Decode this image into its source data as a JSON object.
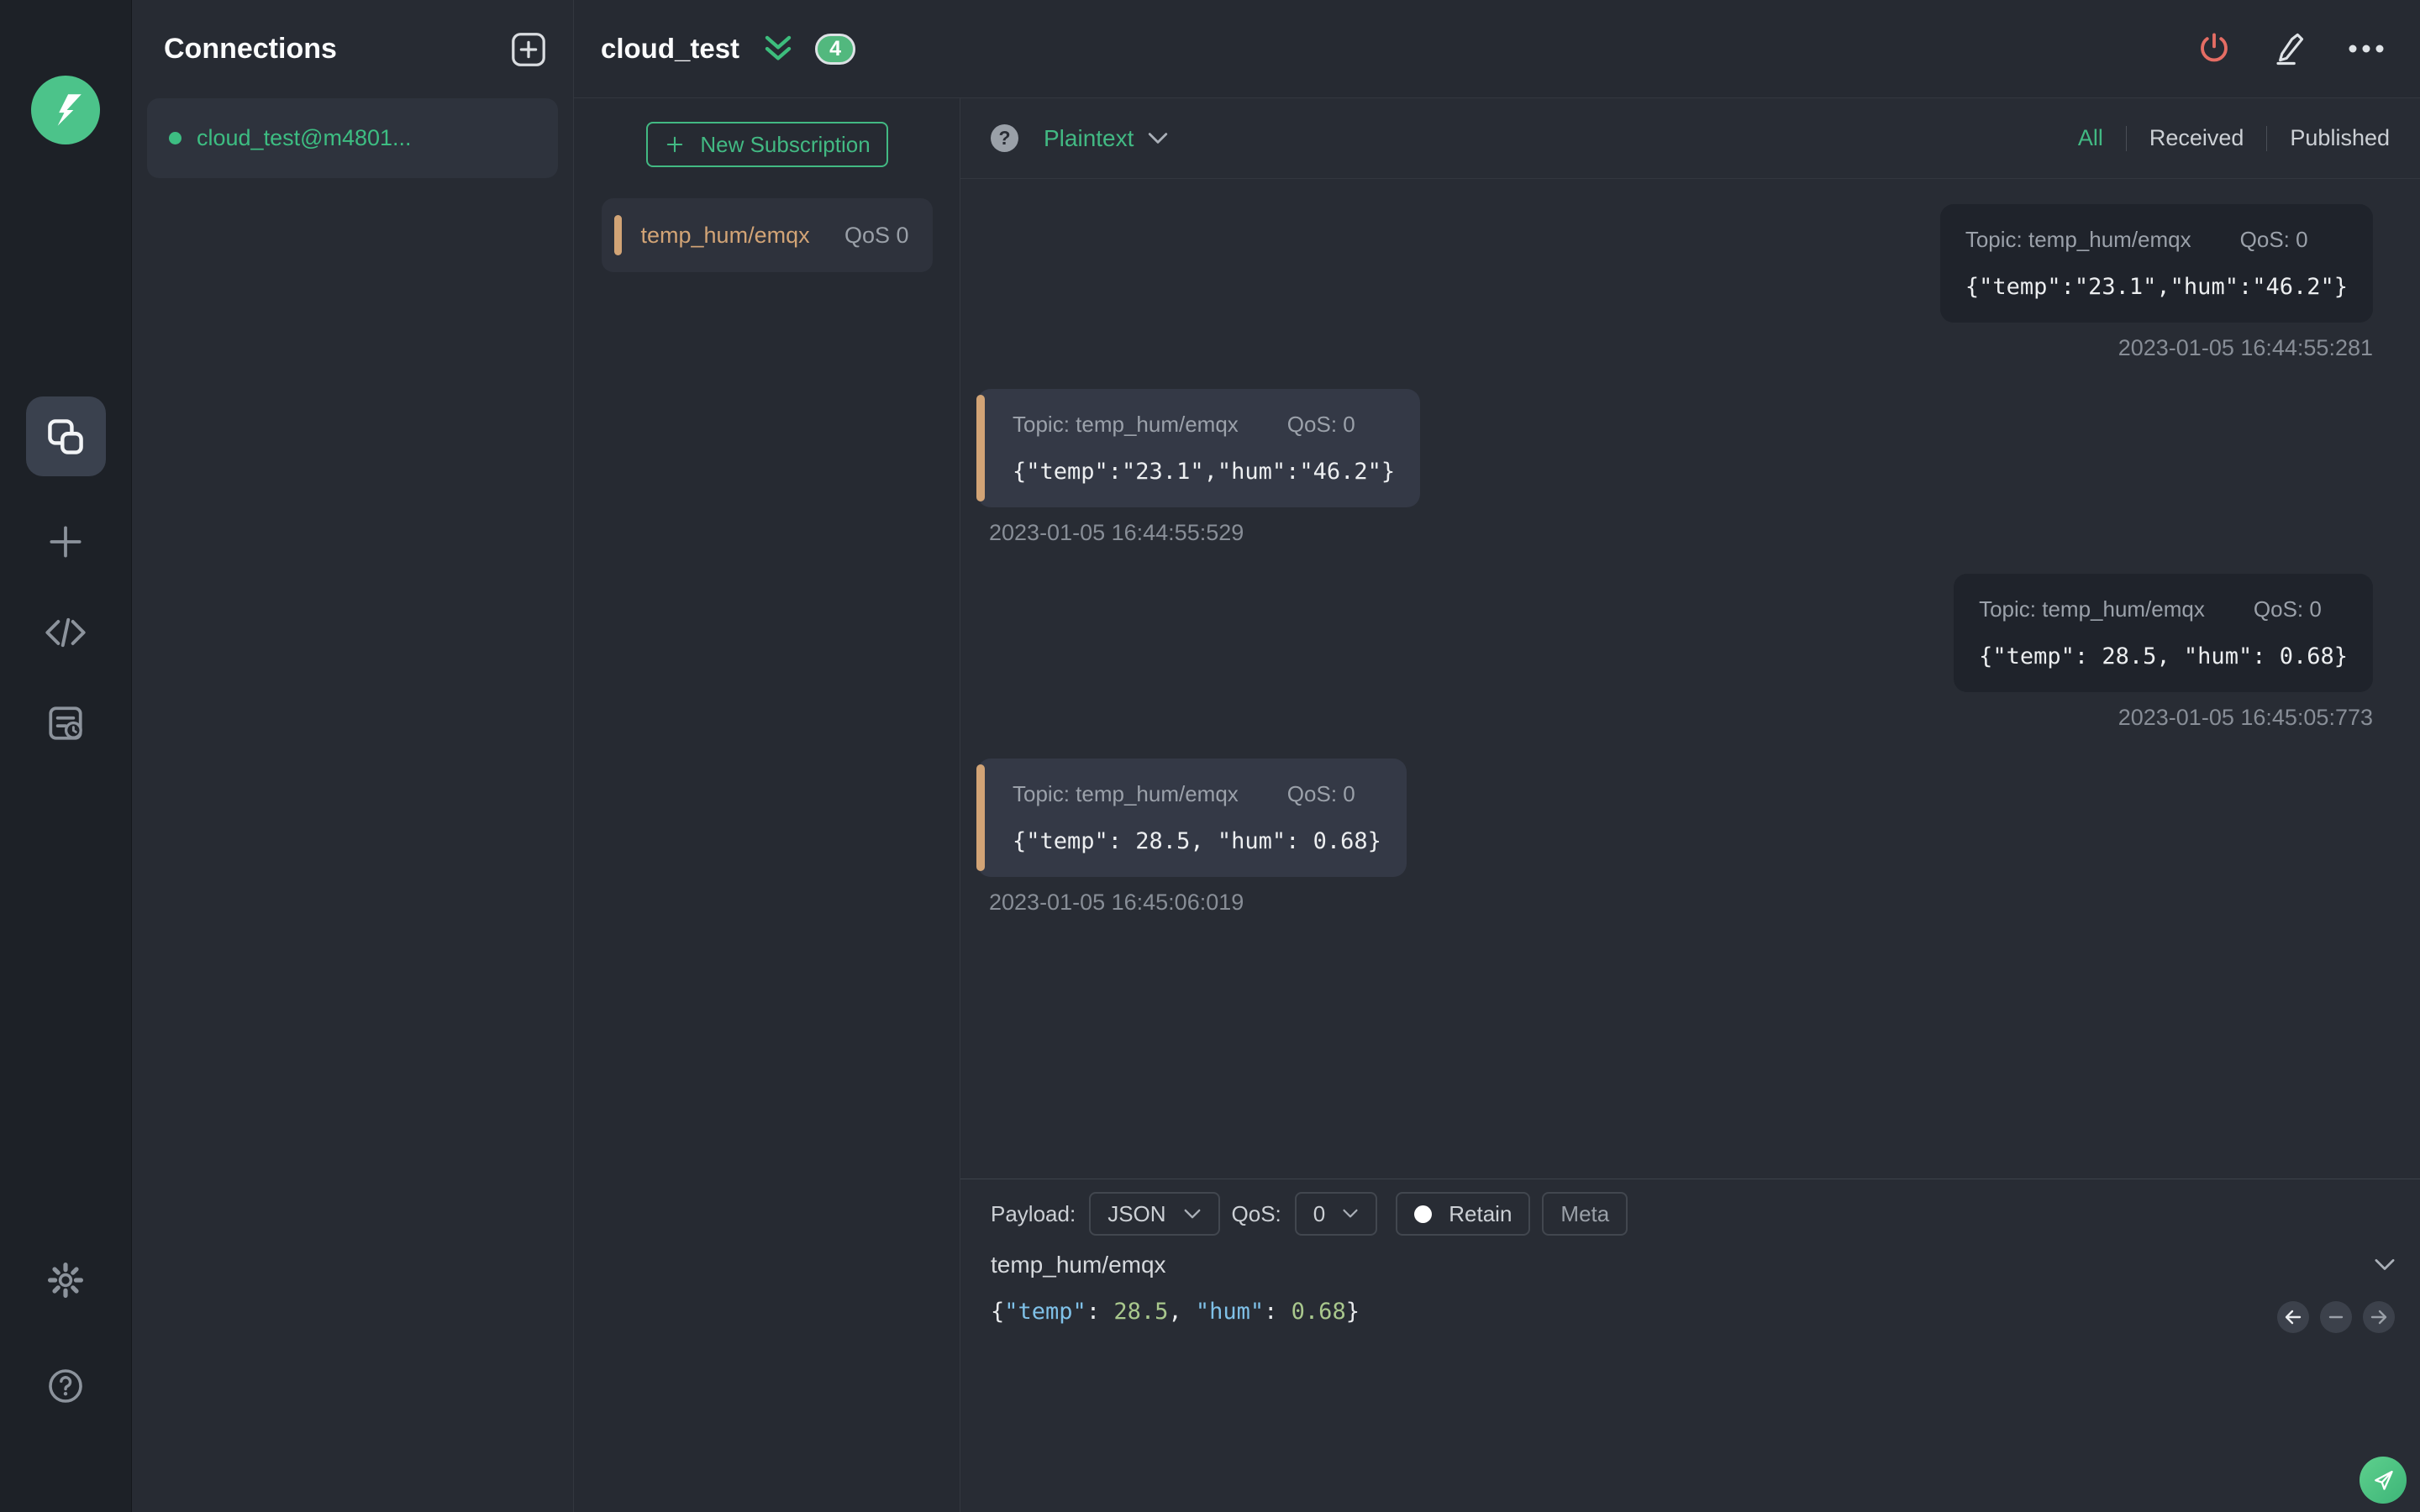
{
  "connections_panel": {
    "title": "Connections",
    "connection_name": "cloud_test@m4801..."
  },
  "header": {
    "title": "cloud_test",
    "message_count": "4"
  },
  "subscriptions": {
    "new_subscription_label": "New Subscription",
    "item": {
      "topic": "temp_hum/emqx",
      "qos": "QoS 0"
    }
  },
  "msgs_toolbar": {
    "help_glyph": "?",
    "format": "Plaintext",
    "filter_all": "All",
    "filter_received": "Received",
    "filter_published": "Published"
  },
  "messages": [
    {
      "direction": "published",
      "topic_label": "Topic: temp_hum/emqx",
      "qos_label": "QoS: 0",
      "payload": "{\"temp\":\"23.1\",\"hum\":\"46.2\"}",
      "timestamp": "2023-01-05 16:44:55:281"
    },
    {
      "direction": "received",
      "topic_label": "Topic: temp_hum/emqx",
      "qos_label": "QoS: 0",
      "payload": "{\"temp\":\"23.1\",\"hum\":\"46.2\"}",
      "timestamp": "2023-01-05 16:44:55:529"
    },
    {
      "direction": "published",
      "topic_label": "Topic: temp_hum/emqx",
      "qos_label": "QoS: 0",
      "payload": "{\"temp\": 28.5, \"hum\": 0.68}",
      "timestamp": "2023-01-05 16:45:05:773"
    },
    {
      "direction": "received",
      "topic_label": "Topic: temp_hum/emqx",
      "qos_label": "QoS: 0",
      "payload": "{\"temp\": 28.5, \"hum\": 0.68}",
      "timestamp": "2023-01-05 16:45:06:019"
    }
  ],
  "publish": {
    "payload_label": "Payload:",
    "format": "JSON",
    "qos_label": "QoS:",
    "qos": "0",
    "retain_label": "Retain",
    "meta_label": "Meta",
    "topic": "temp_hum/emqx",
    "editor": {
      "open": "{",
      "key1": "\"temp\"",
      "colon1": ": ",
      "num1": "28.5",
      "comma": ", ",
      "key2": "\"hum\"",
      "colon2": ": ",
      "num2": "0.68",
      "close": "}"
    }
  },
  "colors": {
    "accent_green": "#42b983",
    "subscription_orange": "#d2a476",
    "disconnect_red": "#e56d64",
    "badge_green": "#52b87e"
  }
}
